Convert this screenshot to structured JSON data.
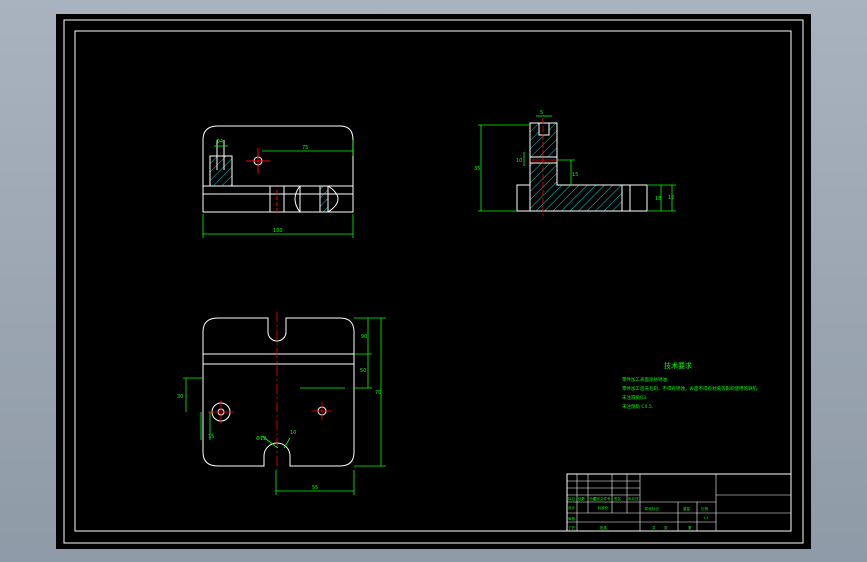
{
  "colors": {
    "background": "#8f9aa7",
    "sheet": "#000000",
    "frame": "#ffffff",
    "geometry": "#ffffff",
    "dimension": "#00ff00",
    "centerline": "#ff0000",
    "hatch": "#00ffff"
  },
  "front_view": {
    "dims": {
      "left_small": "Φ4",
      "right_len": "75",
      "total_width": "100"
    }
  },
  "side_view": {
    "dims": {
      "top_small": "5",
      "left_height": "35",
      "mid1": "10",
      "mid2": "15",
      "right1": "18",
      "right2": "12"
    }
  },
  "top_view": {
    "dims": {
      "r1": "90",
      "r2": "50",
      "r3": "70",
      "left_h": "30",
      "left_v": "15",
      "circle_a": "Φ12",
      "circle_b": "10",
      "bottom_w": "55"
    }
  },
  "tech": {
    "title": "技术要求",
    "lines": [
      "零件加工表面涂防锈油.",
      "零件加工后去毛刺，不得有锈蚀，表面不得有划痕等影响使用的缺陷.",
      "未注圆角R3.",
      "未注倒角 C0.5."
    ]
  },
  "title_block": {
    "labels": [
      "标记",
      "处数",
      "分区",
      "更改文件号",
      "签名",
      "年月日",
      "设计",
      "标准化",
      "阶段标记",
      "重量",
      "比例",
      "审核",
      "工艺",
      "批准",
      "共",
      "张",
      "第"
    ],
    "scale": "1:1"
  }
}
